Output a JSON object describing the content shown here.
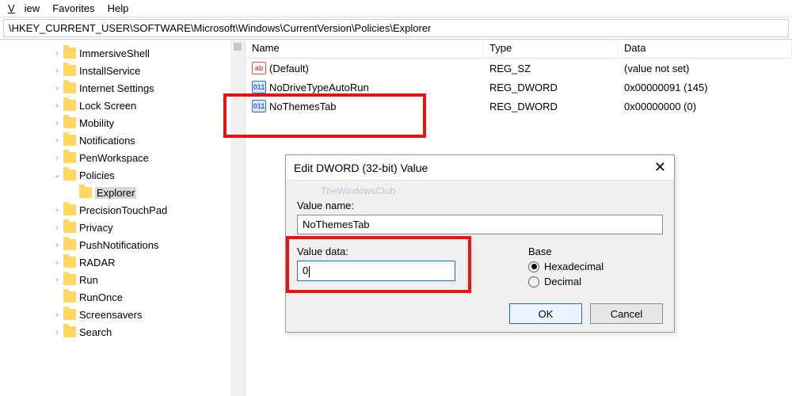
{
  "menu": {
    "view": "View",
    "favorites": "Favorites",
    "help": "Help"
  },
  "path": "\\HKEY_CURRENT_USER\\SOFTWARE\\Microsoft\\Windows\\CurrentVersion\\Policies\\Explorer",
  "tree": {
    "items": [
      {
        "label": "ImmersiveShell",
        "expandable": true
      },
      {
        "label": "InstallService",
        "expandable": true
      },
      {
        "label": "Internet Settings",
        "expandable": true
      },
      {
        "label": "Lock Screen",
        "expandable": true
      },
      {
        "label": "Mobility",
        "expandable": true
      },
      {
        "label": "Notifications",
        "expandable": true
      },
      {
        "label": "PenWorkspace",
        "expandable": true
      },
      {
        "label": "Policies",
        "expandable": true,
        "expanded": true,
        "children": [
          {
            "label": "Explorer",
            "selected": true
          }
        ]
      },
      {
        "label": "PrecisionTouchPad",
        "expandable": true
      },
      {
        "label": "Privacy",
        "expandable": true
      },
      {
        "label": "PushNotifications",
        "expandable": true
      },
      {
        "label": "RADAR",
        "expandable": true
      },
      {
        "label": "Run",
        "expandable": true
      },
      {
        "label": "RunOnce",
        "expandable": false
      },
      {
        "label": "Screensavers",
        "expandable": true
      },
      {
        "label": "Search",
        "expandable": true
      }
    ]
  },
  "list": {
    "columns": {
      "name": "Name",
      "type": "Type",
      "data": "Data"
    },
    "rows": [
      {
        "icon": "sz",
        "name": "(Default)",
        "type": "REG_SZ",
        "data": "(value not set)"
      },
      {
        "icon": "dw",
        "name": "NoDriveTypeAutoRun",
        "type": "REG_DWORD",
        "data": "0x00000091 (145)"
      },
      {
        "icon": "dw",
        "name": "NoThemesTab",
        "type": "REG_DWORD",
        "data": "0x00000000 (0)"
      }
    ]
  },
  "dialog": {
    "title": "Edit DWORD (32-bit) Value",
    "watermark": "TheWindowsClub",
    "value_name_label": "Value name:",
    "value_name": "NoThemesTab",
    "value_data_label": "Value data:",
    "value_data": "0",
    "base_label": "Base",
    "hex_label": "Hexadecimal",
    "dec_label": "Decimal",
    "ok": "OK",
    "cancel": "Cancel"
  }
}
